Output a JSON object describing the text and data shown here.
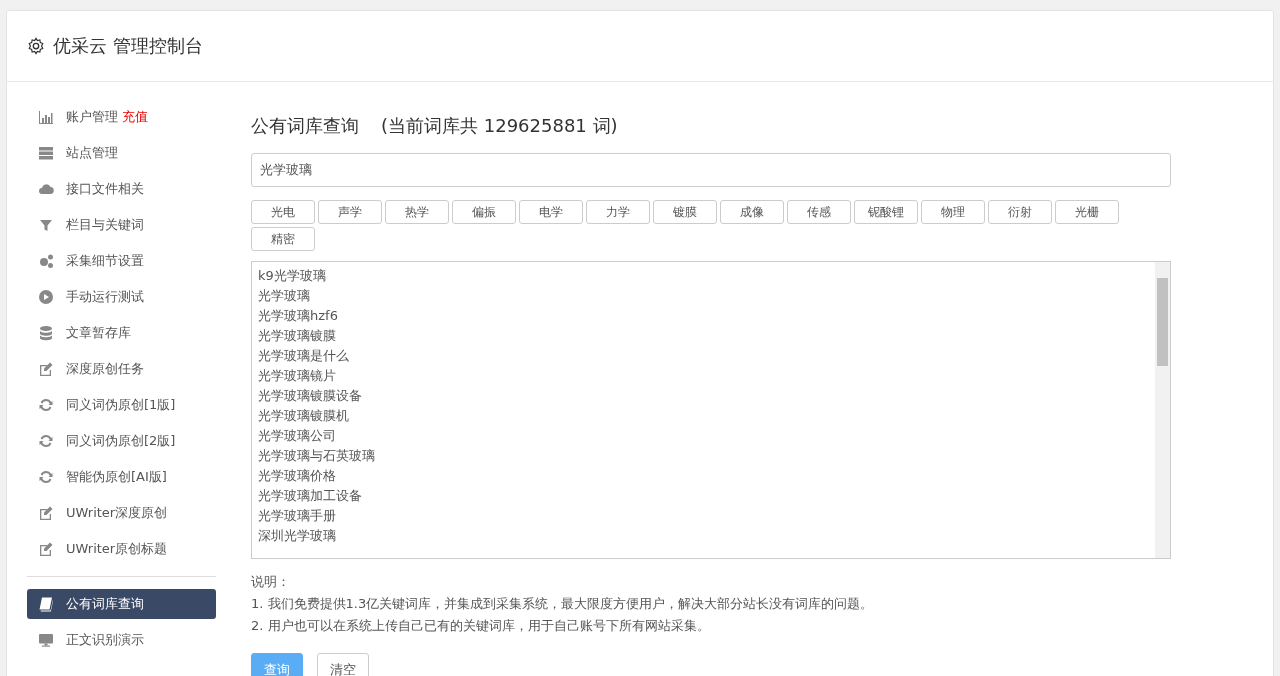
{
  "header": {
    "title": "优采云 管理控制台"
  },
  "sidebar": {
    "sections": [
      [
        {
          "label": "账户管理",
          "badge": "充值",
          "kind": "chart",
          "selected": false
        },
        {
          "label": "站点管理",
          "kind": "server",
          "selected": false
        },
        {
          "label": "接口文件相关",
          "kind": "cloud",
          "selected": false
        },
        {
          "label": "栏目与关键词",
          "kind": "filter",
          "selected": false
        },
        {
          "label": "采集细节设置",
          "kind": "gears",
          "selected": false
        },
        {
          "label": "手动运行测试",
          "kind": "play",
          "selected": false
        },
        {
          "label": "文章暂存库",
          "kind": "database",
          "selected": false
        },
        {
          "label": "深度原创任务",
          "kind": "edit",
          "selected": false
        },
        {
          "label": "同义词伪原创[1版]",
          "kind": "refresh",
          "selected": false
        },
        {
          "label": "同义词伪原创[2版]",
          "kind": "refresh",
          "selected": false
        },
        {
          "label": "智能伪原创[AI版]",
          "kind": "refresh",
          "selected": false
        },
        {
          "label": "UWriter深度原创",
          "kind": "edit",
          "selected": false
        },
        {
          "label": "UWriter原创标题",
          "kind": "edit",
          "selected": false
        }
      ],
      [
        {
          "label": "公有词库查询",
          "kind": "book",
          "selected": true
        },
        {
          "label": "正文识别演示",
          "kind": "monitor",
          "selected": false
        }
      ]
    ]
  },
  "main": {
    "title": "公有词库查询",
    "subtitle": "(当前词库共 129625881 词)",
    "search": {
      "value": "光学玻璃"
    },
    "tags": [
      "光电",
      "声学",
      "热学",
      "偏振",
      "电学",
      "力学",
      "镀膜",
      "成像",
      "传感",
      "铌酸锂",
      "物理",
      "衍射",
      "光栅",
      "精密"
    ],
    "results": [
      "k9光学玻璃",
      "光学玻璃",
      "光学玻璃hzf6",
      "光学玻璃镀膜",
      "光学玻璃是什么",
      "光学玻璃镜片",
      "光学玻璃镀膜设备",
      "光学玻璃镀膜机",
      "光学玻璃公司",
      "光学玻璃与石英玻璃",
      "光学玻璃价格",
      "光学玻璃加工设备",
      "光学玻璃手册",
      "深圳光学玻璃"
    ],
    "notes_title": "说明：",
    "notes": [
      "1. 我们免费提供1.3亿关键词库，并集成到采集系统，最大限度方便用户，解决大部分站长没有词库的问题。",
      "2. 用户也可以在系统上传自己已有的关键词库，用于自己账号下所有网站采集。"
    ],
    "buttons": [
      {
        "label": "查询",
        "kind": "primary"
      },
      {
        "label": "清空",
        "kind": "default"
      }
    ]
  }
}
